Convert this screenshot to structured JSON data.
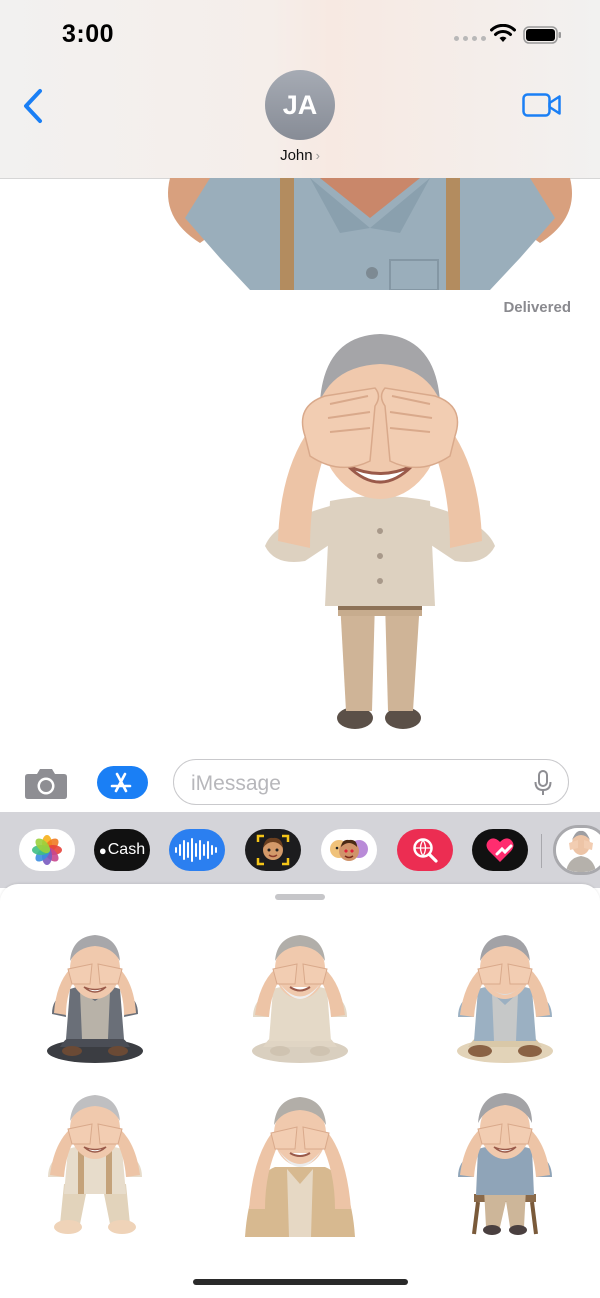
{
  "status_bar": {
    "time": "3:00"
  },
  "header": {
    "avatar_initials": "JA",
    "contact_name": "John",
    "contact_chevron": "›",
    "back_icon": "chevron-left-icon",
    "video_icon": "video-camera-icon"
  },
  "conversation": {
    "delivered_label": "Delivered"
  },
  "compose": {
    "placeholder": "iMessage",
    "camera_icon": "camera-icon",
    "apps_icon": "app-store-icon",
    "mic_icon": "microphone-icon"
  },
  "app_strip": {
    "apps": [
      {
        "name": "photos",
        "icon": "photos-icon"
      },
      {
        "name": "apple-cash",
        "label": "Cash",
        "icon": "apple-cash-icon"
      },
      {
        "name": "audio-message",
        "icon": "waveform-icon"
      },
      {
        "name": "memoji",
        "icon": "memoji-icon"
      },
      {
        "name": "memoji-stickers",
        "icon": "memoji-stickers-icon"
      },
      {
        "name": "images-search",
        "icon": "globe-search-icon"
      },
      {
        "name": "digital-touch",
        "icon": "heart-touch-icon"
      },
      {
        "name": "sticker-pack",
        "icon": "sticker-pack-icon"
      }
    ]
  },
  "sticker_panel": {
    "stickers": [
      {
        "name": "man-cross-legged-grey-shirt"
      },
      {
        "name": "bearded-man-beige-seated"
      },
      {
        "name": "man-blue-shirt-cross-legged"
      },
      {
        "name": "man-suspenders-sitting"
      },
      {
        "name": "bearded-man-cardigan"
      },
      {
        "name": "man-on-chair"
      }
    ]
  },
  "colors": {
    "accent": "#1a7ff5",
    "header_bg": "#f3eeeb",
    "drawer_bg": "#d4d4d9",
    "secondary_text": "#8a8a8f"
  }
}
